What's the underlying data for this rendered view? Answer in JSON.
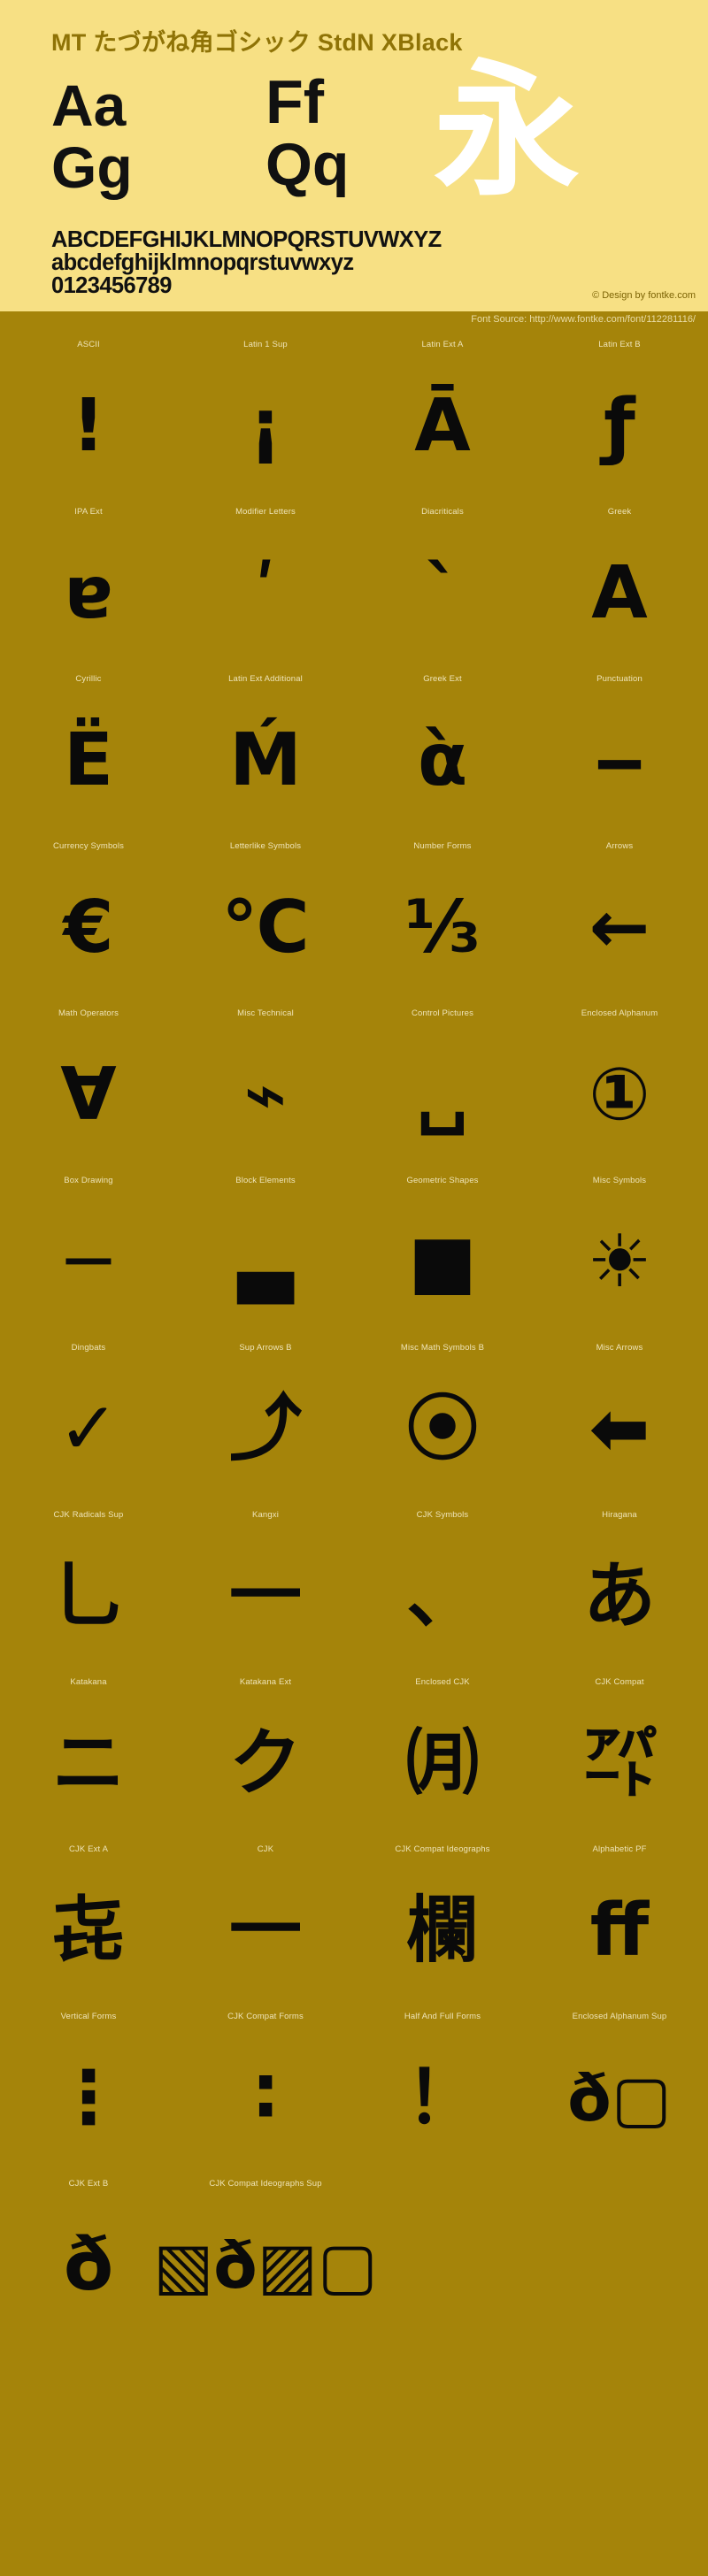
{
  "header": {
    "font_title": "MT たづがね角ゴシック StdN XBlack",
    "samples": {
      "aa": "Aa",
      "ff": "Ff",
      "gg": "Gg",
      "qq": "Qq",
      "cjk": "永"
    },
    "alphabet_uppercase": "ABCDEFGHIJKLMNOPQRSTUVWXYZ",
    "alphabet_lowercase": "abcdefghijklmnopqrstuvwxyz",
    "digits": "0123456789",
    "design_credit": "© Design by fontke.com"
  },
  "source_bar": {
    "text": "Font Source: http://www.fontke.com/font/112281116/"
  },
  "colors": {
    "header_background": "#F7E084",
    "body_background": "#A5840A",
    "title_text": "#8F7306",
    "glyph_black": "#0a0a0a",
    "glyph_white": "#FFFFFF",
    "label_text": "#EFE4B8"
  },
  "blocks": [
    {
      "label": "ASCII",
      "glyph": "!",
      "size": "normal"
    },
    {
      "label": "Latin 1 Sup",
      "glyph": "¡",
      "size": "normal"
    },
    {
      "label": "Latin Ext A",
      "glyph": "Ā",
      "size": "normal"
    },
    {
      "label": "Latin Ext B",
      "glyph": "ƒ",
      "size": "normal"
    },
    {
      "label": "IPA Ext",
      "glyph": "ɐ",
      "size": "normal"
    },
    {
      "label": "Modifier Letters",
      "glyph": "ʹ",
      "size": "normal"
    },
    {
      "label": "Diacriticals",
      "glyph": "ˋ",
      "size": "normal"
    },
    {
      "label": "Greek",
      "glyph": "Α",
      "size": "normal"
    },
    {
      "label": "Cyrillic",
      "glyph": "Ё",
      "size": "normal"
    },
    {
      "label": "Latin Ext Additional",
      "glyph": "Ḿ",
      "size": "normal"
    },
    {
      "label": "Greek Ext",
      "glyph": "ὰ",
      "size": "normal"
    },
    {
      "label": "Punctuation",
      "glyph": "‒",
      "size": "normal"
    },
    {
      "label": "Currency Symbols",
      "glyph": "€",
      "size": "normal"
    },
    {
      "label": "Letterlike Symbols",
      "glyph": "℃",
      "size": "normal"
    },
    {
      "label": "Number Forms",
      "glyph": "⅓",
      "size": "normal"
    },
    {
      "label": "Arrows",
      "glyph": "←",
      "size": "normal"
    },
    {
      "label": "Math Operators",
      "glyph": "∀",
      "size": "normal"
    },
    {
      "label": "Misc Technical",
      "glyph": "⌁",
      "size": "normal"
    },
    {
      "label": "Control Pictures",
      "glyph": "␣",
      "size": "normal"
    },
    {
      "label": "Enclosed Alphanum",
      "glyph": "①",
      "size": "normal"
    },
    {
      "label": "Box Drawing",
      "glyph": "─",
      "size": "normal"
    },
    {
      "label": "Block Elements",
      "glyph": "▃",
      "size": "normal"
    },
    {
      "label": "Geometric Shapes",
      "glyph": "■",
      "size": "normal"
    },
    {
      "label": "Misc Symbols",
      "glyph": "☀",
      "size": "normal"
    },
    {
      "label": "Dingbats",
      "glyph": "✓",
      "size": "normal"
    },
    {
      "label": "Sup Arrows B",
      "glyph": "⤴",
      "size": "normal"
    },
    {
      "label": "Misc Math Symbols B",
      "glyph": "⦿",
      "size": "normal"
    },
    {
      "label": "Misc Arrows",
      "glyph": "⬅",
      "size": "normal"
    },
    {
      "label": "CJK Radicals Sup",
      "glyph": "⺃",
      "size": "normal"
    },
    {
      "label": "Kangxi",
      "glyph": "⼀",
      "size": "normal"
    },
    {
      "label": "CJK Symbols",
      "glyph": "、",
      "size": "normal"
    },
    {
      "label": "Hiragana",
      "glyph": "あ",
      "size": "normal"
    },
    {
      "label": "Katakana",
      "glyph": "ニ",
      "size": "normal"
    },
    {
      "label": "Katakana Ext",
      "glyph": "ク",
      "size": "normal"
    },
    {
      "label": "Enclosed CJK",
      "glyph": "㈪",
      "size": "normal"
    },
    {
      "label": "CJK Compat",
      "glyph": "㌀",
      "size": "normal"
    },
    {
      "label": "CJK Ext A",
      "glyph": "㐂",
      "size": "normal"
    },
    {
      "label": "CJK",
      "glyph": "一",
      "size": "normal"
    },
    {
      "label": "CJK Compat Ideographs",
      "glyph": "欄",
      "size": "normal"
    },
    {
      "label": "Alphabetic PF",
      "glyph": "ﬀ",
      "size": "normal"
    },
    {
      "label": "Vertical Forms",
      "glyph": "⋮",
      "size": "normal"
    },
    {
      "label": "CJK Compat Forms",
      "glyph": "∶",
      "size": "normal"
    },
    {
      "label": "Half And Full Forms",
      "glyph": "！",
      "size": "normal"
    },
    {
      "label": "Enclosed Alphanum Sup",
      "glyph": "ð▢",
      "size": "wide"
    },
    {
      "label": "CJK Ext B",
      "glyph": "ð",
      "size": "normal"
    },
    {
      "label": "CJK Compat Ideographs Sup",
      "glyph": "▧ð▨▢",
      "size": "wide"
    },
    {
      "label": "",
      "glyph": "",
      "size": "normal"
    },
    {
      "label": "",
      "glyph": "",
      "size": "normal"
    }
  ]
}
